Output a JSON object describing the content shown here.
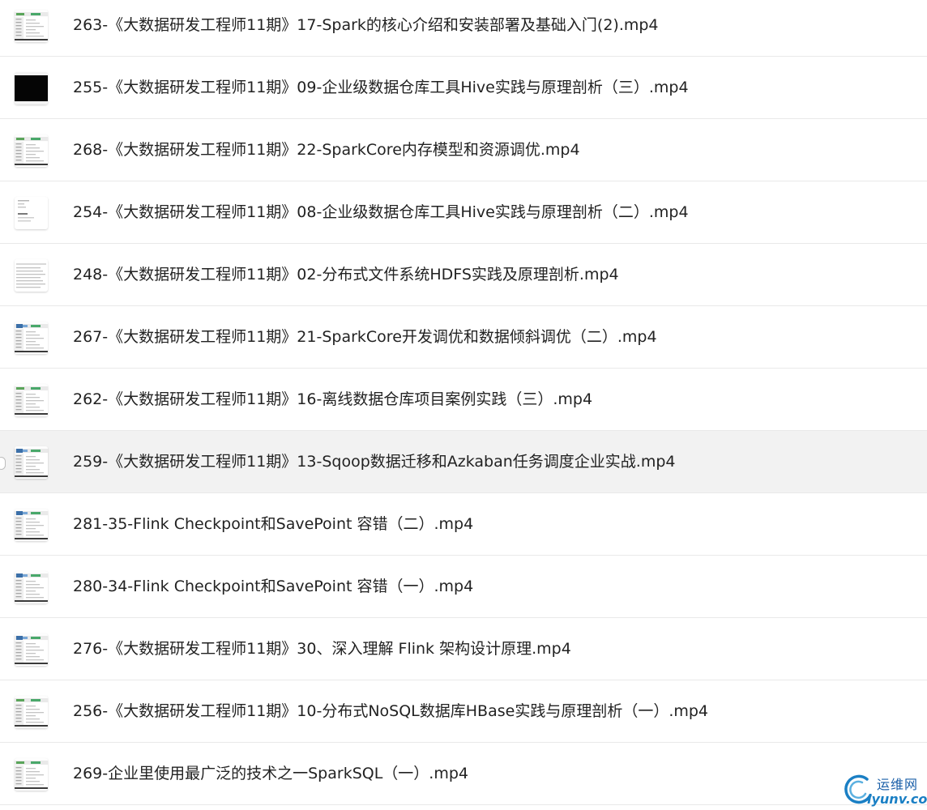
{
  "files": [
    {
      "name": "263-《大数据研发工程师11期》17-Spark的核心介绍和安装部署及基础入门(2).mp4",
      "thumb": "ide-green"
    },
    {
      "name": "255-《大数据研发工程师11期》09-企业级数据仓库工具Hive实践与原理剖析（三）.mp4",
      "thumb": "black"
    },
    {
      "name": "268-《大数据研发工程师11期》22-SparkCore内存模型和资源调优.mp4",
      "thumb": "ide-green"
    },
    {
      "name": "254-《大数据研发工程师11期》08-企业级数据仓库工具Hive实践与原理剖析（二）.mp4",
      "thumb": "document"
    },
    {
      "name": "248-《大数据研发工程师11期》02-分布式文件系统HDFS实践及原理剖析.mp4",
      "thumb": "table"
    },
    {
      "name": "267-《大数据研发工程师11期》21-SparkCore开发调优和数据倾斜调优（二）.mp4",
      "thumb": "ide-blue"
    },
    {
      "name": "262-《大数据研发工程师11期》16-离线数据仓库项目案例实践（三）.mp4",
      "thumb": "ide-green"
    },
    {
      "name": "259-《大数据研发工程师11期》13-Sqoop数据迁移和Azkaban任务调度企业实战.mp4",
      "thumb": "ide-blue",
      "hover": true
    },
    {
      "name": "281-35-Flink Checkpoint和SavePoint 容错（二）.mp4",
      "thumb": "ide-blue"
    },
    {
      "name": "280-34-Flink Checkpoint和SavePoint 容错（一）.mp4",
      "thumb": "ide-blue"
    },
    {
      "name": "276-《大数据研发工程师11期》30、深入理解 Flink 架构设计原理.mp4",
      "thumb": "ide-blue"
    },
    {
      "name": "256-《大数据研发工程师11期》10-分布式NoSQL数据库HBase实践与原理剖析（一）.mp4",
      "thumb": "ide-green"
    },
    {
      "name": "269-企业里使用最广泛的技术之一SparkSQL（一）.mp4",
      "thumb": "ide-green"
    }
  ],
  "watermark": {
    "cn": "运维网",
    "en": "iyunv.com"
  }
}
